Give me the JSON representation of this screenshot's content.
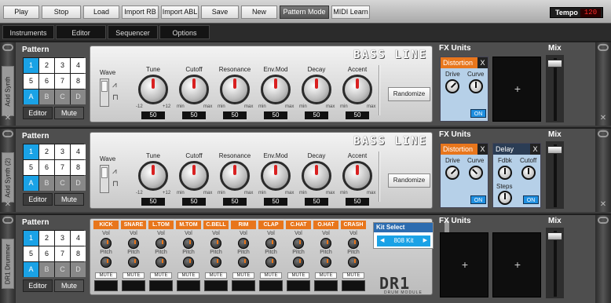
{
  "toolbar": {
    "buttons": [
      "Play",
      "Stop",
      "Load",
      "Import RB",
      "Import ABL",
      "Save",
      "New",
      "Pattern Mode",
      "MIDI Learn"
    ],
    "tempo_label": "Tempo",
    "tempo_value": "120"
  },
  "nav": [
    "Instruments",
    "Editor",
    "Sequencer",
    "Options"
  ],
  "pattern_grid": [
    "1",
    "2",
    "3",
    "4",
    "5",
    "6",
    "7",
    "8",
    "A",
    "B",
    "C",
    "D"
  ],
  "synths": [
    {
      "name": "Acid Synth",
      "pattern_title": "Pattern",
      "edit": "Editor",
      "mute": "Mute",
      "logo": "BASS LINE",
      "wave_label": "Wave",
      "randomize": "Randomize",
      "knobs": [
        {
          "label": "Tune",
          "min": "-12",
          "max": "+12",
          "value": "50"
        },
        {
          "label": "Cutoff",
          "min": "min",
          "max": "max",
          "value": "50"
        },
        {
          "label": "Resonance",
          "min": "min",
          "max": "max",
          "value": "50"
        },
        {
          "label": "Env.Mod",
          "min": "min",
          "max": "max",
          "value": "50"
        },
        {
          "label": "Decay",
          "min": "min",
          "max": "max",
          "value": "50"
        },
        {
          "label": "Accent",
          "min": "min",
          "max": "max",
          "value": "50"
        }
      ],
      "fx_title": "FX Units",
      "mix_title": "Mix",
      "fx": [
        {
          "name": "Distortion",
          "close": "X",
          "k1": "Drive",
          "k2": "Curve",
          "on": "ON"
        }
      ]
    },
    {
      "name": "Acid Synth (2)",
      "pattern_title": "Pattern",
      "edit": "Editor",
      "mute": "Mute",
      "logo": "BASS LINE",
      "wave_label": "Wave",
      "randomize": "Randomize",
      "knobs": [
        {
          "label": "Tune",
          "min": "-12",
          "max": "+12",
          "value": "50"
        },
        {
          "label": "Cutoff",
          "min": "min",
          "max": "max",
          "value": "50"
        },
        {
          "label": "Resonance",
          "min": "min",
          "max": "max",
          "value": "50"
        },
        {
          "label": "Env.Mod",
          "min": "min",
          "max": "max",
          "value": "50"
        },
        {
          "label": "Decay",
          "min": "min",
          "max": "max",
          "value": "50"
        },
        {
          "label": "Accent",
          "min": "min",
          "max": "max",
          "value": "50"
        }
      ],
      "fx_title": "FX Units",
      "mix_title": "Mix",
      "fx": [
        {
          "name": "Distortion",
          "close": "X",
          "k1": "Drive",
          "k2": "Curve",
          "on": "ON"
        },
        {
          "name": "Delay",
          "close": "X",
          "k1": "Fdbk",
          "k2": "Cutoff",
          "k3": "Steps",
          "on": "ON"
        }
      ]
    }
  ],
  "drum": {
    "name": "DR1 Drummer",
    "pattern_title": "Pattern",
    "edit": "Editor",
    "mute": "Mute",
    "channels": [
      "KICK",
      "SNARE",
      "L.TOM",
      "M.TOM",
      "C.BELL",
      "RIM",
      "CLAP",
      "C.HAT",
      "O.HAT",
      "CRASH"
    ],
    "vol": "Vol",
    "pitch": "Pitch",
    "mute_btn": "MUTE",
    "kit_select": "Kit Select",
    "kit_value": "808 Kit",
    "logo": "DR1",
    "logo_sub": "DRUM MODULE",
    "fx_title": "FX Units",
    "mix_title": "Mix"
  }
}
